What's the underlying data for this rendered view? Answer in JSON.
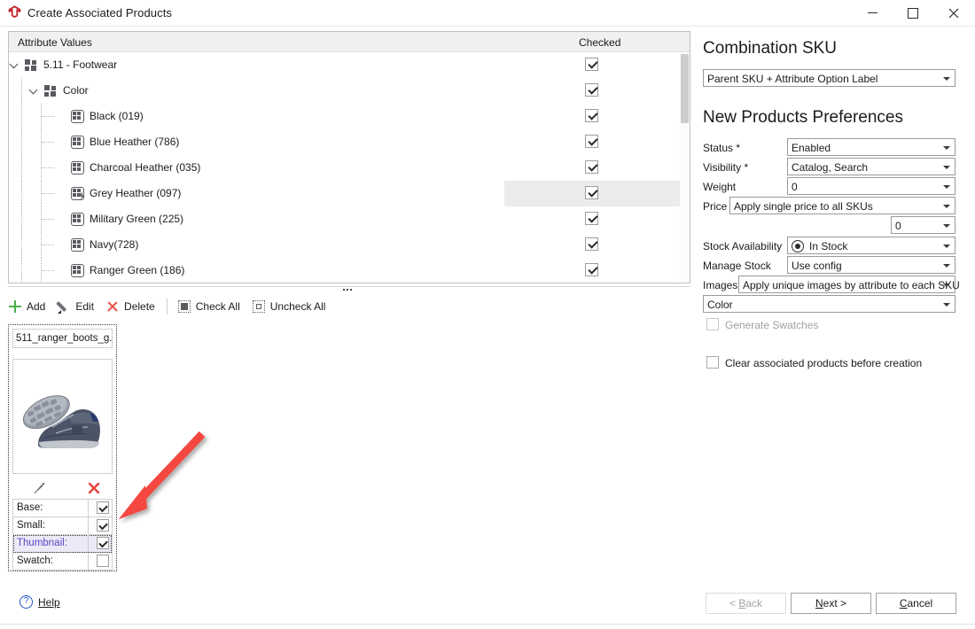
{
  "window": {
    "title": "Create Associated Products",
    "app_icon": "magento-logo-icon",
    "minimize": "–",
    "maximize": "□",
    "close": "✕"
  },
  "tree": {
    "columns": {
      "attribute": "Attribute Values",
      "checked": "Checked"
    },
    "rows": [
      {
        "label": "5.11 - Footwear",
        "level": 0,
        "type": "folder",
        "expanded": true,
        "checked": true,
        "highlighted": false,
        "bolt": false
      },
      {
        "label": "Color",
        "level": 1,
        "type": "folder",
        "expanded": true,
        "checked": true,
        "highlighted": false,
        "bolt": false
      },
      {
        "label": "Black (019)",
        "level": 2,
        "type": "leaf",
        "checked": true,
        "highlighted": false,
        "bolt": false
      },
      {
        "label": "Blue Heather (786)",
        "level": 2,
        "type": "leaf",
        "checked": true,
        "highlighted": false,
        "bolt": false
      },
      {
        "label": "Charcoal Heather (035)",
        "level": 2,
        "type": "leaf",
        "checked": true,
        "highlighted": false,
        "bolt": false
      },
      {
        "label": "Grey Heather (097)",
        "level": 2,
        "type": "leaf",
        "checked": true,
        "highlighted": true,
        "bolt": true
      },
      {
        "label": "Military Green (225)",
        "level": 2,
        "type": "leaf",
        "checked": true,
        "highlighted": false,
        "bolt": false
      },
      {
        "label": "Navy(728)",
        "level": 2,
        "type": "leaf",
        "checked": true,
        "highlighted": false,
        "bolt": false
      },
      {
        "label": "Ranger Green (186)",
        "level": 2,
        "type": "leaf",
        "checked": true,
        "highlighted": false,
        "bolt": false
      }
    ]
  },
  "toolbar": {
    "add": "Add",
    "edit": "Edit",
    "delete": "Delete",
    "check_all": "Check All",
    "uncheck_all": "Uncheck All"
  },
  "image_card": {
    "file_name": "511_ranger_boots_g...",
    "edit_icon": "pencil-icon",
    "delete_icon": "close-x-icon",
    "roles": [
      {
        "label": "Base:",
        "checked": true,
        "selected": false
      },
      {
        "label": "Small:",
        "checked": true,
        "selected": false
      },
      {
        "label": "Thumbnail:",
        "checked": true,
        "selected": true
      },
      {
        "label": "Swatch:",
        "checked": false,
        "selected": false
      }
    ]
  },
  "right": {
    "combination_heading": "Combination SKU",
    "combination_value": "Parent SKU + Attribute Option Label",
    "preferences_heading": "New Products Preferences",
    "fields": [
      {
        "label": "Status *",
        "value": "Enabled"
      },
      {
        "label": "Visibility *",
        "value": "Catalog, Search"
      },
      {
        "label": "Weight",
        "value": "0"
      },
      {
        "label": "Price",
        "value": "Apply single price to all SKUs"
      },
      {
        "label": "",
        "value": "0"
      },
      {
        "label": "Stock Availability",
        "value": "In Stock"
      },
      {
        "label": "Manage Stock",
        "value": "Use config"
      },
      {
        "label": "Images",
        "value": "Apply unique images by attribute to each SKU"
      },
      {
        "label": "",
        "value": "Color"
      }
    ],
    "generate_swatches": {
      "label": "Generate Swatches",
      "checked": false,
      "disabled": true
    },
    "clear_associated": {
      "label": "Clear associated products before creation",
      "checked": false,
      "disabled": false
    }
  },
  "footer": {
    "help": "Help",
    "back": "< Back",
    "next": "Next >",
    "cancel": "Cancel"
  },
  "colors": {
    "accent_red": "#e8534d",
    "accent_green": "#4caf50",
    "selected_row": "#ebebeb",
    "selected_role": "#5b45c8",
    "link_blue": "#2158c9"
  }
}
